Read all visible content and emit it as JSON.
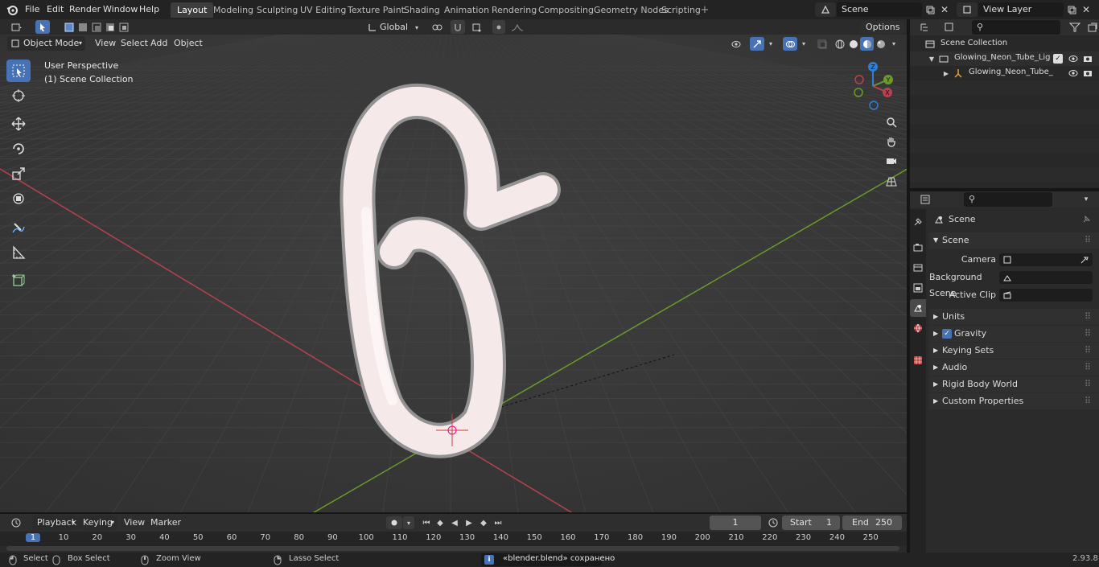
{
  "app": {
    "version": "2.93.8"
  },
  "menus": [
    "File",
    "Edit",
    "Render",
    "Window",
    "Help"
  ],
  "workspaces": [
    {
      "label": "Layout",
      "active": true
    },
    {
      "label": "Modeling"
    },
    {
      "label": "Sculpting"
    },
    {
      "label": "UV Editing"
    },
    {
      "label": "Texture Paint"
    },
    {
      "label": "Shading"
    },
    {
      "label": "Animation"
    },
    {
      "label": "Rendering"
    },
    {
      "label": "Compositing"
    },
    {
      "label": "Geometry Nodes"
    },
    {
      "label": "Scripting"
    }
  ],
  "scene_field": "Scene",
  "view_layer_field": "View Layer",
  "viewport_header": {
    "mode": "Object Mode",
    "view": "View",
    "select": "Select",
    "add": "Add",
    "object": "Object",
    "orientation": "Global",
    "options": "Options"
  },
  "viewport_overlay": {
    "line1": "User Perspective",
    "line2": "(1) Scene Collection"
  },
  "gizmo_axes": {
    "z": "Z",
    "y": "Y",
    "x": "X"
  },
  "outliner": {
    "root": "Scene Collection",
    "items": [
      {
        "label": "Glowing_Neon_Tube_Light_Di"
      },
      {
        "label": "Glowing_Neon_Tube_Ligl"
      }
    ]
  },
  "properties": {
    "header": "Scene",
    "section": "Scene",
    "camera_label": "Camera",
    "background_label": "Background Scene",
    "clip_label": "Active Clip",
    "panels": [
      "Units",
      "Gravity",
      "Keying Sets",
      "Audio",
      "Rigid Body World",
      "Custom Properties"
    ]
  },
  "timeline": {
    "playback": "Playback",
    "keying": "Keying",
    "view": "View",
    "marker": "Marker",
    "current_frame": "1",
    "start_label": "Start",
    "start_value": "1",
    "end_label": "End",
    "end_value": "250",
    "ruler": [
      "1",
      "10",
      "20",
      "30",
      "40",
      "50",
      "60",
      "70",
      "80",
      "90",
      "100",
      "110",
      "120",
      "130",
      "140",
      "150",
      "160",
      "170",
      "180",
      "190",
      "200",
      "210",
      "220",
      "230",
      "240",
      "250"
    ]
  },
  "statusbar": {
    "select": "Select",
    "box_select": "Box Select",
    "zoom_view": "Zoom View",
    "lasso_select": "Lasso Select",
    "message": "«blender.blend» сохранено",
    "version": "2.93.8"
  },
  "colors": {
    "accent": "#4772b3",
    "x_axis": "#b8414f",
    "y_axis": "#6b9a2a",
    "z_axis": "#2f7fd9"
  }
}
